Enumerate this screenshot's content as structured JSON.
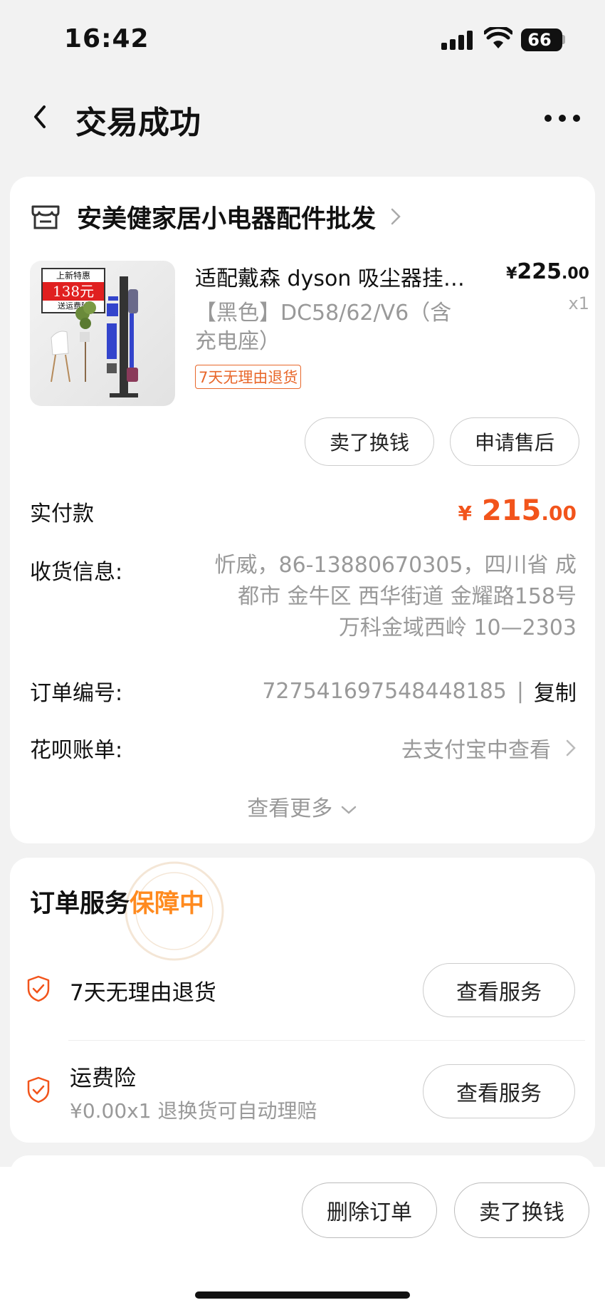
{
  "status": {
    "time": "16:42",
    "battery": "66"
  },
  "nav": {
    "title": "交易成功"
  },
  "store": {
    "name": "安美健家居小电器配件批发"
  },
  "product": {
    "title": "适配戴森 dyson 吸尘器挂…",
    "spec": "【黑色】DC58/62/V6（含充电座）",
    "return_badge": "7天无理由退货",
    "price_currency": "¥",
    "price_int": "225",
    "price_dec": ".00",
    "qty": "x1",
    "promo": {
      "top": "上新特惠",
      "price": "138元",
      "bottom": "送运费险"
    }
  },
  "actions": {
    "sell": "卖了换钱",
    "after_sale": "申请售后"
  },
  "payment": {
    "label": "实付款",
    "currency": "¥",
    "int": "215",
    "dec": ".00"
  },
  "shipping": {
    "label": "收货信息:",
    "line1": "忻威，86-13880670305，四川省 成",
    "line2": "都市 金牛区 西华街道 金耀路158号",
    "line3": "万科金域西岭 10—2303"
  },
  "order": {
    "label": "订单编号:",
    "number": "727541697548448185",
    "separator": "|",
    "copy": "复制"
  },
  "huabei": {
    "label": "花呗账单:",
    "value": "去支付宝中查看"
  },
  "view_more": "查看更多",
  "service": {
    "title_prefix": "订单服务",
    "title_accent": "保障中",
    "items": [
      {
        "name": "7天无理由退货",
        "button": "查看服务"
      },
      {
        "name": "运费险",
        "sub": "¥0.00x1 退换货可自动理赔",
        "button": "查看服务"
      }
    ]
  },
  "bottom": {
    "delete": "删除订单",
    "sell": "卖了换钱"
  },
  "colors": {
    "accent": "#f2541b",
    "guarantee": "#ff8a1f",
    "badge": "#e8672a"
  }
}
